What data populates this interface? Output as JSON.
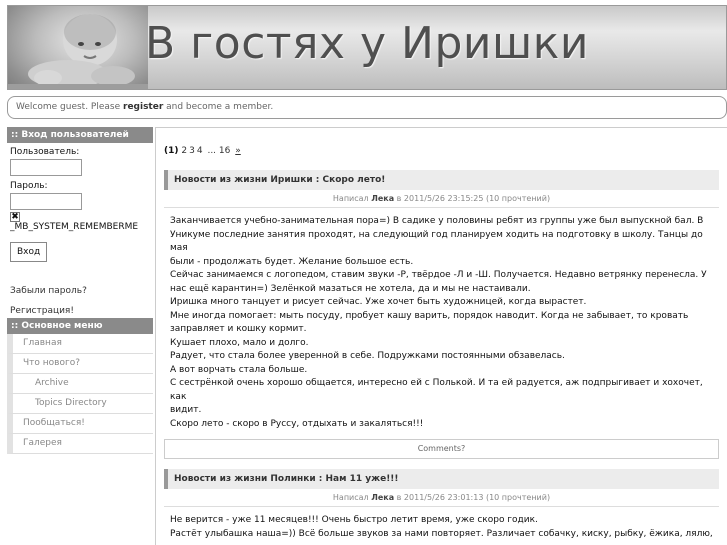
{
  "header": {
    "title": "В гостях у Иришки"
  },
  "welcome": {
    "prefix": "Welcome guest. Please ",
    "link": "register",
    "suffix": " and become a member."
  },
  "login": {
    "title": ":: Вход пользователей",
    "username_label": "Пользователь:",
    "password_label": "Пароль:",
    "remember_label": "_MB_SYSTEM_REMEMBERME",
    "remember_check": "✖",
    "submit": "Вход",
    "forgot": "Забыли пароль?",
    "register": "Регистрация!"
  },
  "menu": {
    "title": ":: Основное меню",
    "items": [
      {
        "label": "Главная"
      },
      {
        "label": "Что нового?"
      },
      {
        "label": "Archive"
      },
      {
        "label": "Topics Directory"
      },
      {
        "label": "Пообщаться!"
      },
      {
        "label": "Галерея"
      }
    ]
  },
  "pager": {
    "current": "(1)",
    "pages": [
      "2",
      "3",
      "4"
    ],
    "ellipsis": "...",
    "last": "16",
    "next": "»"
  },
  "posts": [
    {
      "title": "Новости из жизни Иришки : Скоро лето!",
      "meta_prefix": "Написал ",
      "author": "Лека",
      "meta_suffix": " в 2011/5/26 23:15:25 (10 прочтений)",
      "lines": [
        "Заканчивается учебно-занимательная пора=) В садике у половины ребят из группы уже был выпускной бал. В",
        "Уникуме последние занятия проходят, на следующий год планируем ходить на подготовку в школу. Танцы до мая",
        "были - продолжать будет. Желание большое есть.",
        "Сейчас занимаемся с логопедом, ставим звуки -Р, твёрдое -Л и -Ш. Получается. Недавно ветрянку перенесла. У",
        "нас ещё карантин=) Зелёнкой мазаться не хотела, да и мы не настаивали.",
        "Иришка много танцует и рисует сейчас. Уже хочет быть художницей, когда вырастет.",
        "Мне иногда помогает: мыть посуду, пробует кашу варить, порядок наводит. Когда не забывает, то кровать",
        "заправляет и кошку кормит.",
        "Кушает плохо, мало и долго.",
        "Радует, что стала более уверенной в себе. Подружками постоянными обзавелась.",
        "А вот ворчать стала больше.",
        "С сестрёнкой очень хорошо общается, интересно ей с Полькой. И та ей радуется, аж подпрыгивает и хохочет, как",
        "видит.",
        "Скоро лето - скоро в Руссу, отдыхать и закаляться!!!"
      ],
      "comments": "Comments?"
    },
    {
      "title": "Новости из жизни Полинки : Нам 11 уже!!!",
      "meta_prefix": "Написал ",
      "author": "Лека",
      "meta_suffix": " в 2011/5/26 23:01:13 (10 прочтений)",
      "lines": [
        "Не верится - уже 11 месяцев!!! Очень быстро летит время, уже скоро годик.",
        "Растёт улыбашка наша=)) Всё больше звуков за нами повторяет. Различает собачку, киску, рыбку, ёжика, лялю,"
      ]
    }
  ]
}
